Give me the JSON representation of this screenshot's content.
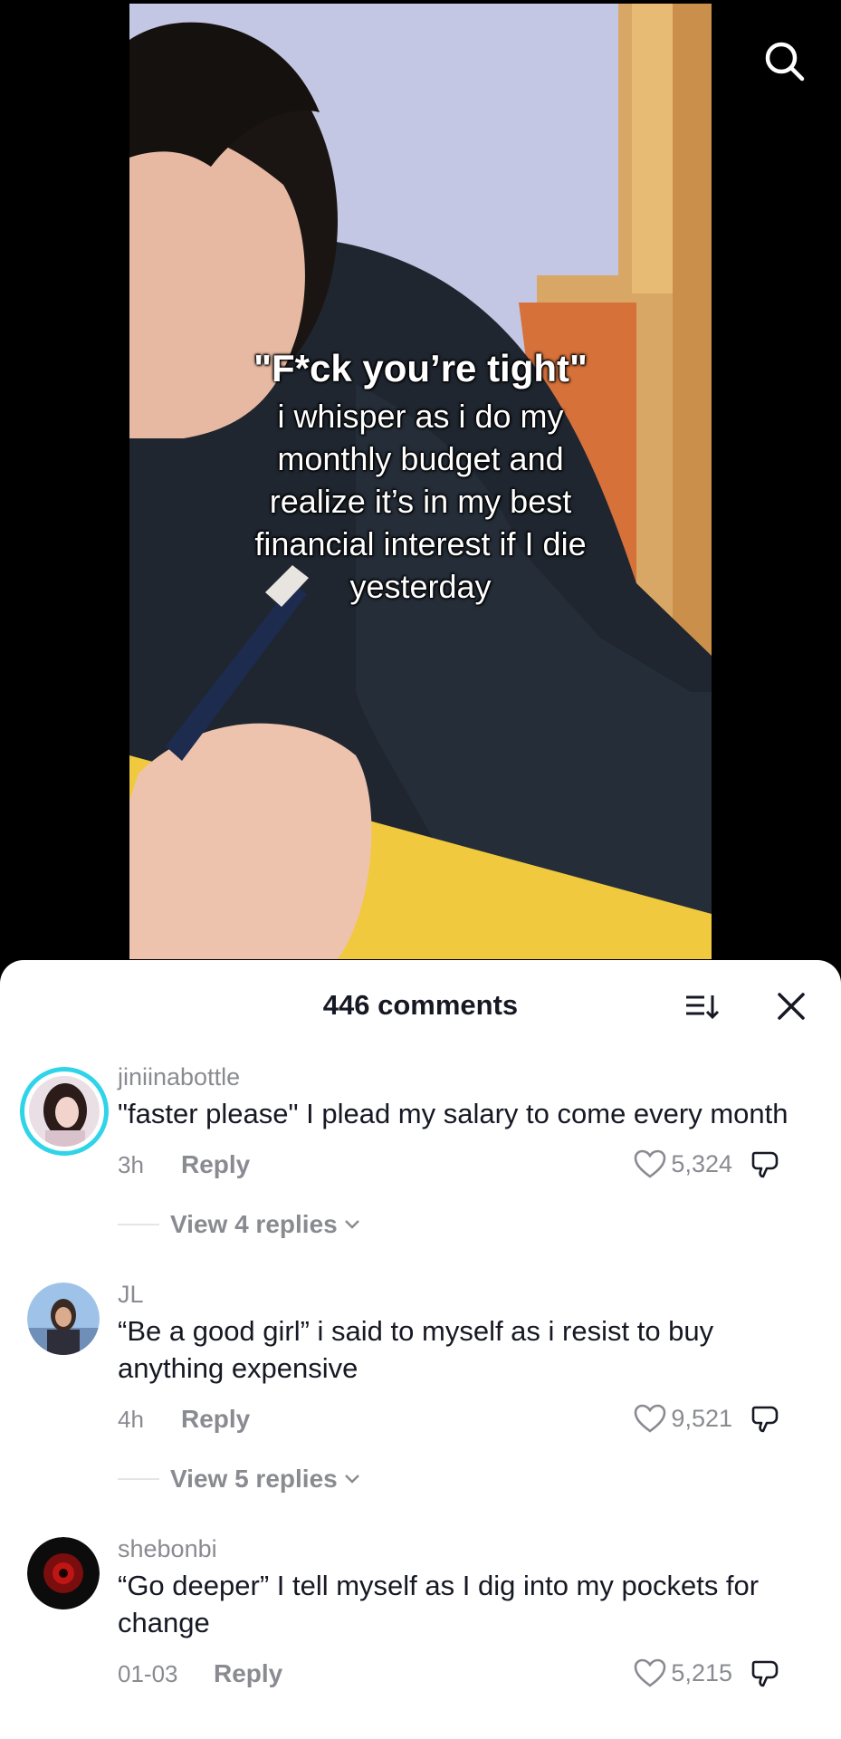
{
  "video": {
    "caption_headline": "\"F*ck you’re tight\"",
    "caption_lines": [
      "i whisper as i do my",
      "monthly budget and",
      "realize it’s in my best",
      "financial interest if I die",
      "yesterday"
    ]
  },
  "comments_sheet": {
    "title": "446 comments",
    "comments": [
      {
        "username": "jiniinabottle",
        "text": "\"faster please\" I plead my salary to come every month",
        "time": "3h",
        "reply_label": "Reply",
        "likes": "5,324",
        "view_replies": "View 4 replies"
      },
      {
        "username": "JL",
        "text": "“Be a good girl” i said to myself as i resist to buy anything expensive",
        "time": "4h",
        "reply_label": "Reply",
        "likes": "9,521",
        "view_replies": "View 5 replies"
      },
      {
        "username": "shebonbi",
        "text": "“Go deeper” I tell myself as I dig into my pockets for change",
        "time": "01-03",
        "reply_label": "Reply",
        "likes": "5,215"
      }
    ]
  },
  "colors": {
    "avatar_ring": "#2fd4e8",
    "muted_text": "#8a8b91",
    "primary_text": "#161823"
  },
  "icons": [
    "search-icon",
    "sort-icon",
    "close-icon",
    "heart-icon",
    "dislike-icon",
    "chevron-down-icon"
  ]
}
